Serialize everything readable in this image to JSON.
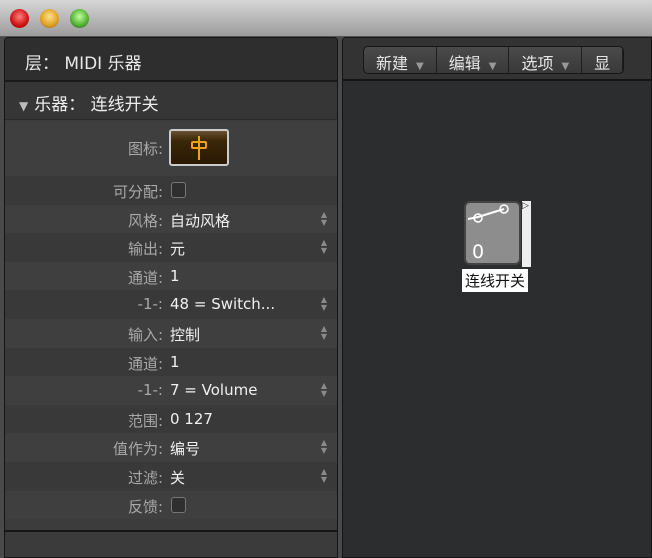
{
  "window": {
    "buttons": [
      "close",
      "minimize",
      "zoom"
    ]
  },
  "inspector": {
    "layer_title": "层： MIDI 乐器",
    "section_title": "乐器： 连线开关",
    "rows": [
      {
        "label": "图标:",
        "type": "icon"
      },
      {
        "label": "可分配:",
        "type": "checkbox",
        "checked": false
      },
      {
        "label": "风格:",
        "value": "自动风格",
        "stepper": true
      },
      {
        "label": "输出:",
        "value": "元",
        "stepper": true
      },
      {
        "label": "通道:",
        "value": "1"
      },
      {
        "label": "-1-:",
        "value": "48 = Switch...",
        "stepper": true
      },
      {
        "label": "输入:",
        "value": "控制",
        "stepper": true
      },
      {
        "label": "通道:",
        "value": "1"
      },
      {
        "label": "-1-:",
        "value": "7 = Volume",
        "stepper": true
      },
      {
        "label": "范围:",
        "value": "0    127"
      },
      {
        "label": "值作为:",
        "value": "编号",
        "stepper": true
      },
      {
        "label": "过滤:",
        "value": "关",
        "stepper": true
      },
      {
        "label": "反馈:",
        "type": "checkbox",
        "checked": false
      }
    ]
  },
  "toolbar": {
    "items": [
      {
        "label": "新建"
      },
      {
        "label": "编辑"
      },
      {
        "label": "选项"
      },
      {
        "label": "显"
      }
    ]
  },
  "canvas": {
    "object": {
      "name": "连线开关",
      "value": "0"
    }
  },
  "colors": {
    "icon_accent": "#f0a020"
  }
}
